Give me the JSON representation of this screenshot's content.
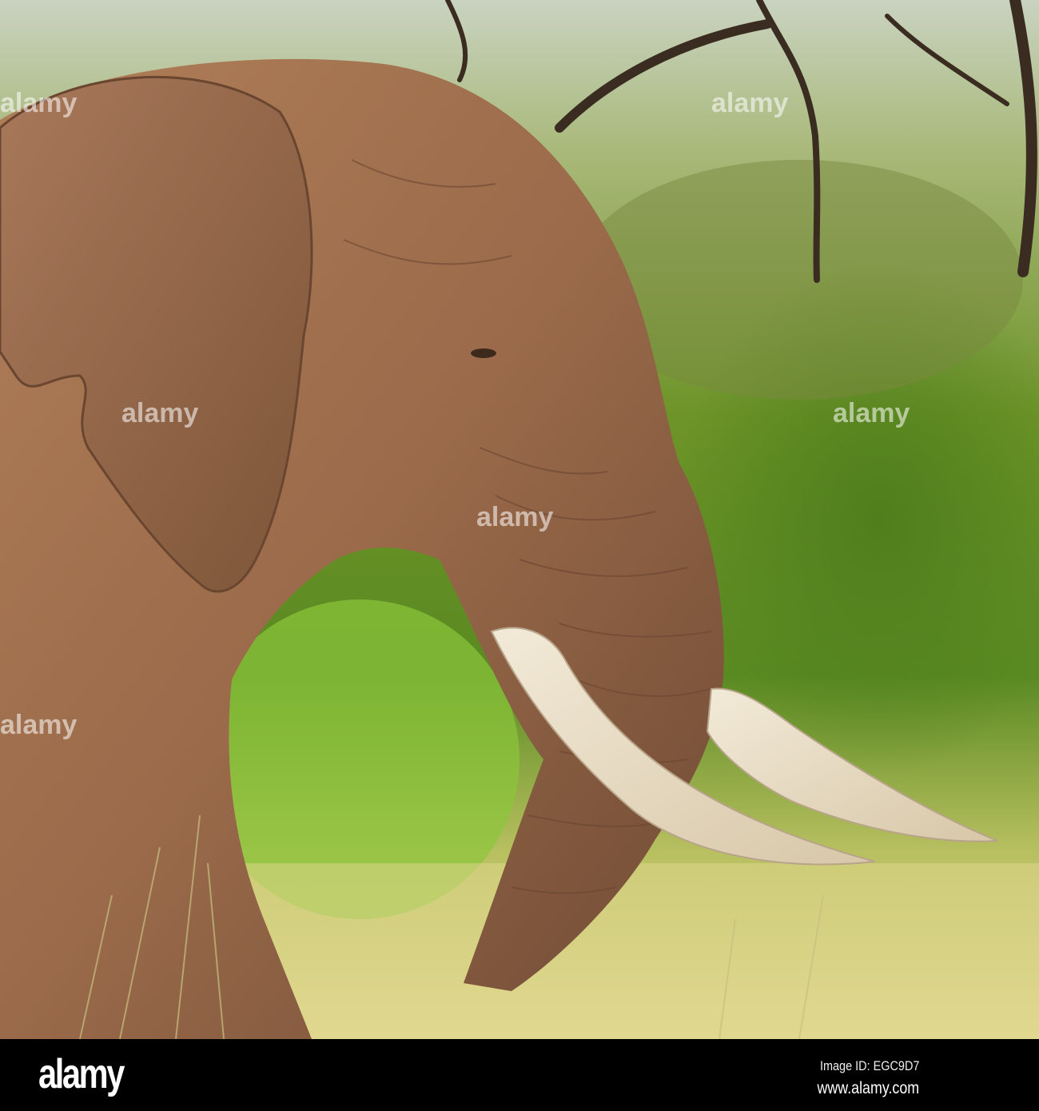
{
  "photo": {
    "subject": "African elephant with tusks in green bush"
  },
  "watermark": {
    "text": "alamy"
  },
  "footer": {
    "logo": "alamy",
    "image_id": "Image ID: EGC9D7",
    "website": "www.alamy.com"
  },
  "colors": {
    "elephant": "#9a6a4a",
    "tusk": "#e8dcc4",
    "foliage": "#6f9a2a",
    "grass": "#d8d07a"
  }
}
